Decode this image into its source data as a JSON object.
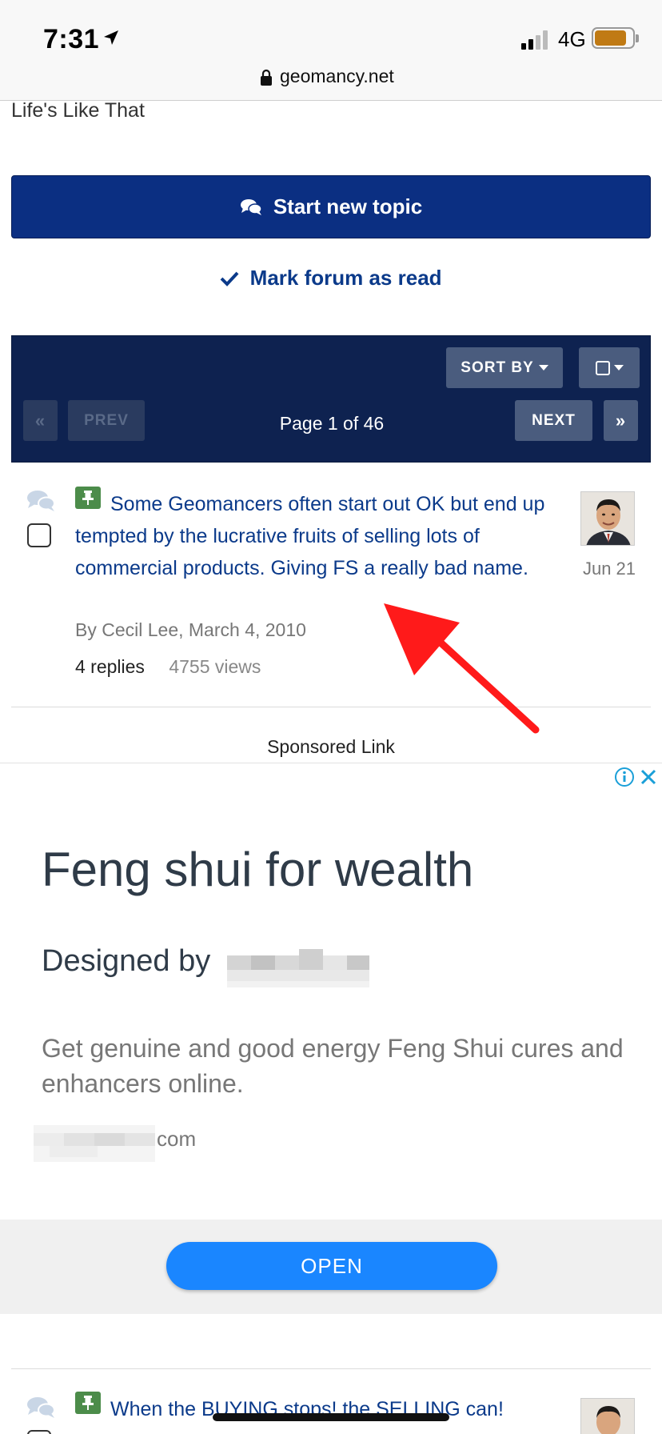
{
  "status_bar": {
    "time": "7:31",
    "network": "4G",
    "battery_level": 0.85,
    "battery_color": "#c07a14"
  },
  "url_bar": {
    "domain": "geomancy.net"
  },
  "forum": {
    "description": "Life's Like That",
    "start_topic_label": "Start new topic",
    "mark_read_label": "Mark forum as read"
  },
  "pagination": {
    "sort_label": "SORT BY",
    "first_label": "«",
    "prev_label": "PREV",
    "page_label": "Page 1 of 46",
    "next_label": "NEXT",
    "last_label": "»"
  },
  "topics": [
    {
      "title": "Some Geomancers often start out OK but end up tempted by the lucrative fruits of selling lots of commercial products. Giving FS a really bad name.",
      "meta": "By Cecil Lee, March 4, 2010",
      "replies": "4 replies",
      "views": "4755 views",
      "date": "Jun 21"
    },
    {
      "title": "When the BUYING stops! the SELLING can!"
    }
  ],
  "ad": {
    "sponsored_label": "Sponsored Link",
    "headline": "Feng shui for wealth",
    "subheadline": "Designed by",
    "body": "Get genuine and good energy Feng Shui cures and enhancers online.",
    "domain_suffix": "com",
    "open_label": "OPEN",
    "accent_color": "#1a86ff"
  },
  "colors": {
    "primary_dark": "#0b2f82",
    "pager_bg": "#0e2250",
    "link": "#0b3a8a",
    "pin_green": "#4c8c4a",
    "annotation_red": "#ff1a1a"
  }
}
